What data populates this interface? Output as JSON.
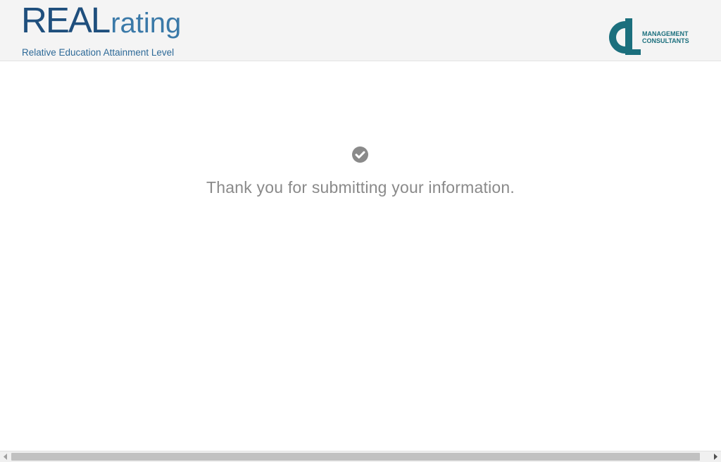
{
  "header": {
    "brand_real": "REAL",
    "brand_rating": "rating",
    "brand_subtitle": "Relative Education Attainment Level",
    "partner_logo": {
      "line1": "MANAGEMENT",
      "line2": "CONSULTANTS",
      "color": "#1b6f7d"
    }
  },
  "main": {
    "status_icon": "check-circle-icon",
    "message": "Thank you for submitting your information."
  },
  "scrollbar": {
    "left_arrow": "scroll-left-arrow-icon",
    "right_arrow": "scroll-right-arrow-icon"
  },
  "colors": {
    "header_bg": "#f4f4f4",
    "brand_dark": "#1f4f7d",
    "brand_light": "#3a79a8",
    "message_text": "#8a8a8a",
    "check_icon": "#8a8a8a"
  }
}
